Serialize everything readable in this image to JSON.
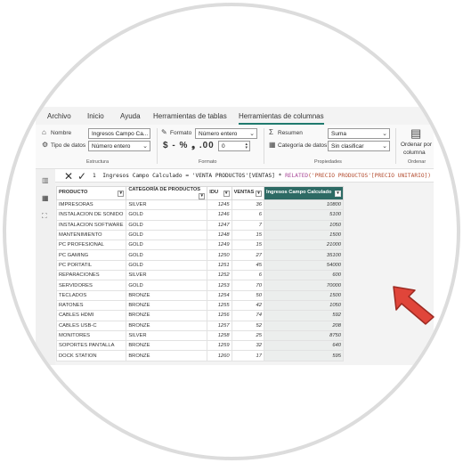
{
  "menu": {
    "tabs": [
      "Archivo",
      "Inicio",
      "Ayuda",
      "Herramientas de tablas",
      "Herramientas de columnas"
    ],
    "active_tab": "Herramientas de columnas"
  },
  "ribbon": {
    "nombre_label": "Nombre",
    "nombre_value": "Ingresos Campo Ca...",
    "tipo_label": "Tipo de datos",
    "tipo_value": "Número entero",
    "estructura_group": "Estructura",
    "formato_label": "Formato",
    "formato_value": "Número entero",
    "formato_symbols": "$ - % ❟ .00",
    "decimal_value": "0",
    "formato_group": "Formato",
    "resumen_label": "Resumen",
    "resumen_value": "Suma",
    "categoria_label": "Categoría de datos",
    "categoria_value": "Sin clasificar",
    "propiedades_group": "Propiedades",
    "ordenar_label_1": "Ordenar por",
    "ordenar_label_2": "columna",
    "ordenar_group": "Ordenar"
  },
  "formula_bar": {
    "line_no": "1",
    "prefix": "Ingresos Campo Calculado = 'VENTA PRODUCTOS'[VENTAS] * ",
    "function": "RELATED",
    "argument": "('PRECIO PRODUCTOS'[PRECIO UNITARIO])"
  },
  "table": {
    "columns": [
      "PRODUCTO",
      "CATEGORÍA DE PRODUCTOS",
      "IDU",
      "VENTAS",
      "Ingresos Campo Calculado"
    ],
    "rows": [
      [
        "IMPRESORAS",
        "SILVER",
        "1245",
        "36",
        "10800"
      ],
      [
        "INSTALACION DE SONIDO",
        "GOLD",
        "1246",
        "6",
        "5100"
      ],
      [
        "INSTALACION SOFTWARE",
        "GOLD",
        "1247",
        "7",
        "1050"
      ],
      [
        "MANTENIMIENTO",
        "GOLD",
        "1248",
        "15",
        "1500"
      ],
      [
        "PC PROFESIONAL",
        "GOLD",
        "1249",
        "15",
        "21000"
      ],
      [
        "PC GAMING",
        "GOLD",
        "1250",
        "27",
        "35100"
      ],
      [
        "PC PORTATIL",
        "GOLD",
        "1251",
        "45",
        "54000"
      ],
      [
        "REPARACIONES",
        "SILVER",
        "1252",
        "6",
        "600"
      ],
      [
        "SERVIDORES",
        "GOLD",
        "1253",
        "70",
        "70000"
      ],
      [
        "TECLADOS",
        "BRONZE",
        "1254",
        "50",
        "1500"
      ],
      [
        "RATONES",
        "BRONZE",
        "1255",
        "42",
        "1050"
      ],
      [
        "CABLES HDMI",
        "BRONZE",
        "1256",
        "74",
        "592"
      ],
      [
        "CABLES USB-C",
        "BRONZE",
        "1257",
        "52",
        "208"
      ],
      [
        "MONITORES",
        "SILVER",
        "1258",
        "25",
        "8750"
      ],
      [
        "SOPORTES PANTALLA",
        "BRONZE",
        "1259",
        "32",
        "640"
      ],
      [
        "DOCK STATION",
        "BRONZE",
        "1260",
        "17",
        "595"
      ]
    ]
  },
  "colors": {
    "accent": "#1f7a6e",
    "selected_column_header": "#2d6a64",
    "arrow": "#e0453a"
  }
}
